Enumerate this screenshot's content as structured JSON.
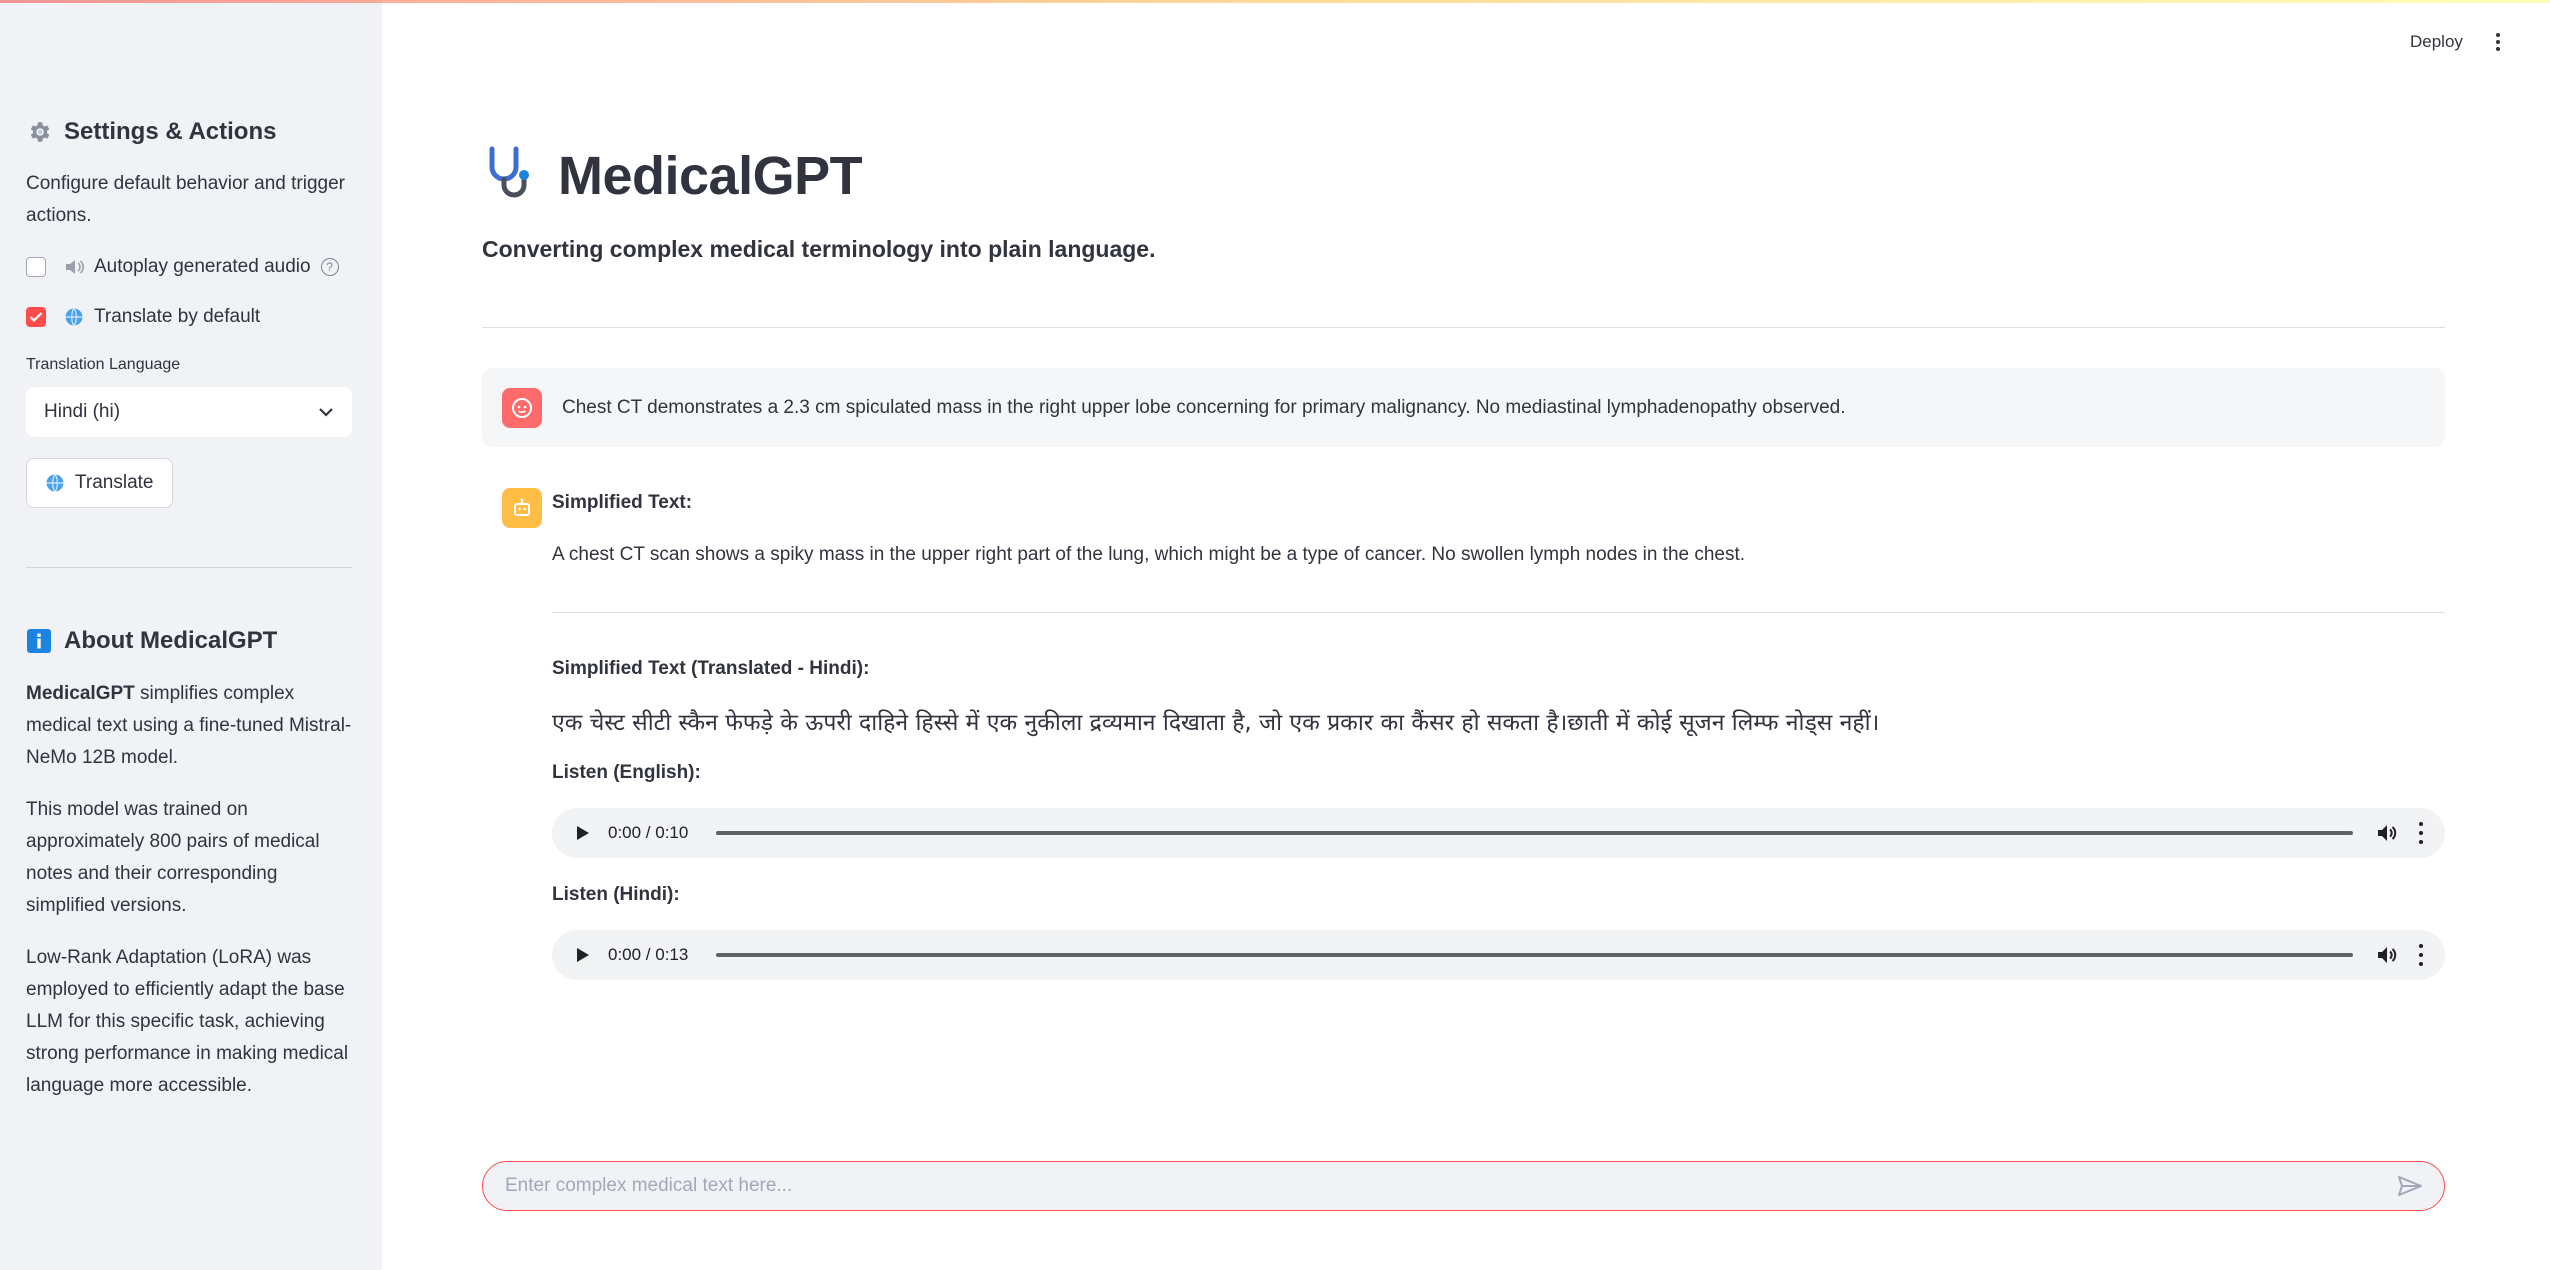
{
  "sidebar": {
    "settings_title": "Settings & Actions",
    "settings_desc": "Configure default behavior and trigger actions.",
    "autoplay_label": "Autoplay generated audio",
    "autoplay_checked": false,
    "translate_default_label": "Translate by default",
    "translate_default_checked": true,
    "language_label": "Translation Language",
    "language_value": "Hindi (hi)",
    "translate_button": "Translate",
    "about_title": "About MedicalGPT",
    "about_p1_bold": "MedicalGPT",
    "about_p1_rest": " simplifies complex medical text using a fine-tuned Mistral-NeMo 12B model.",
    "about_p2": "This model was trained on approximately 800 pairs of medical notes and their corresponding simplified versions.",
    "about_p3": "Low-Rank Adaptation (LoRA) was employed to efficiently adapt the base LLM for this specific task, achieving strong performance in making medical language more accessible."
  },
  "header": {
    "deploy_label": "Deploy"
  },
  "main": {
    "title": "MedicalGPT",
    "subtitle": "Converting complex medical terminology into plain language.",
    "user_message": "Chest CT demonstrates a 2.3 cm spiculated mass in the right upper lobe concerning for primary malignancy. No mediastinal lymphadenopathy observed.",
    "simplified_label": "Simplified Text:",
    "simplified_text": "A chest CT scan shows a spiky mass in the upper right part of the lung, which might be a type of cancer. No swollen lymph nodes in the chest.",
    "translated_label": "Simplified Text (Translated - Hindi):",
    "translated_text": "एक चेस्ट सीटी स्कैन फेफड़े के ऊपरी दाहिने हिस्से में एक नुकीला द्रव्यमान दिखाता है, जो एक प्रकार का कैंसर हो सकता है।छाती में कोई सूजन लिम्फ नोड्स नहीं।",
    "listen_english_label": "Listen (English):",
    "audio_english_time": "0:00 / 0:10",
    "listen_hindi_label": "Listen (Hindi):",
    "audio_hindi_time": "0:00 / 0:13"
  },
  "chat_input": {
    "placeholder": "Enter complex medical text here..."
  },
  "colors": {
    "accent": "#ff4b4b",
    "sidebar_bg": "#f0f2f6",
    "user_avatar": "#ff6b6b",
    "bot_avatar": "#ffbd45",
    "info_icon": "#1c83e1"
  }
}
